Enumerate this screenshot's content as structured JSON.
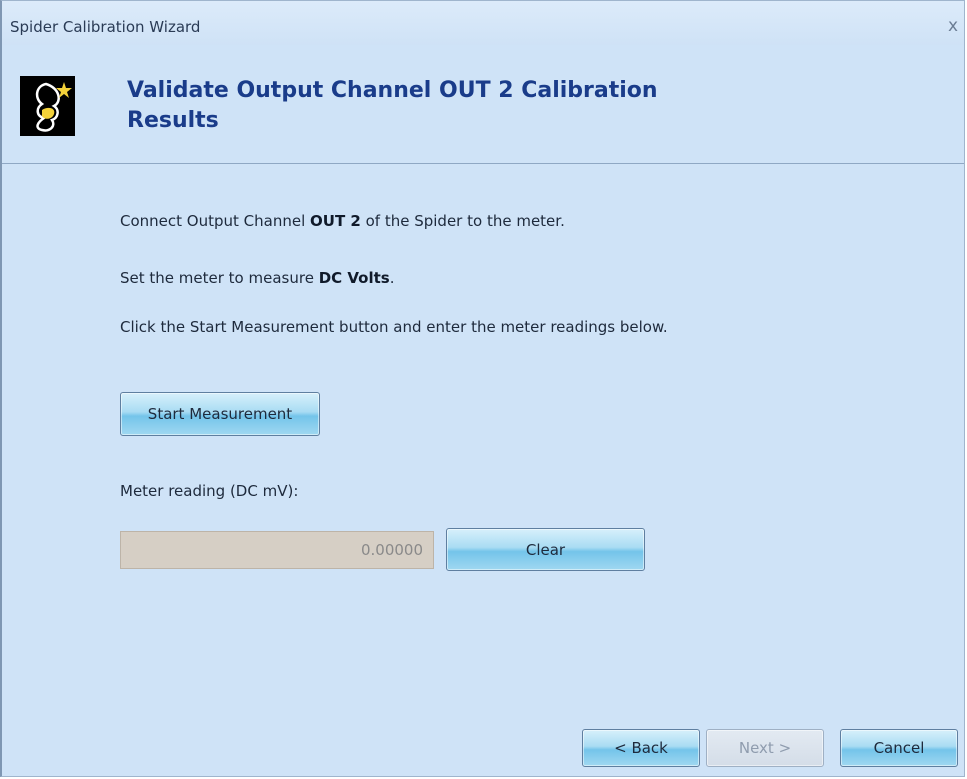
{
  "window": {
    "title": "Spider Calibration Wizard",
    "close_glyph": "x"
  },
  "header": {
    "heading": "Validate Output Channel OUT 2 Calibration Results",
    "logo_icon": "spider-logo-icon"
  },
  "instructions": {
    "line1_prefix": "Connect Output Channel ",
    "line1_bold": "OUT 2",
    "line1_suffix": " of the Spider to the meter.",
    "line2_prefix": "Set the meter to measure ",
    "line2_bold": "DC Volts",
    "line2_suffix": ".",
    "line3": "Click the Start Measurement button and enter the meter readings below."
  },
  "measurement": {
    "start_button": "Start Measurement",
    "reading_label": "Meter reading (DC mV):",
    "reading_value": "0.00000",
    "clear_button": "Clear"
  },
  "footer": {
    "back_button": "< Back",
    "next_button": "Next >",
    "cancel_button": "Cancel"
  },
  "colors": {
    "background": "#cfe3f7",
    "heading": "#1a3c8a",
    "button_accent": "#74c4ea"
  }
}
